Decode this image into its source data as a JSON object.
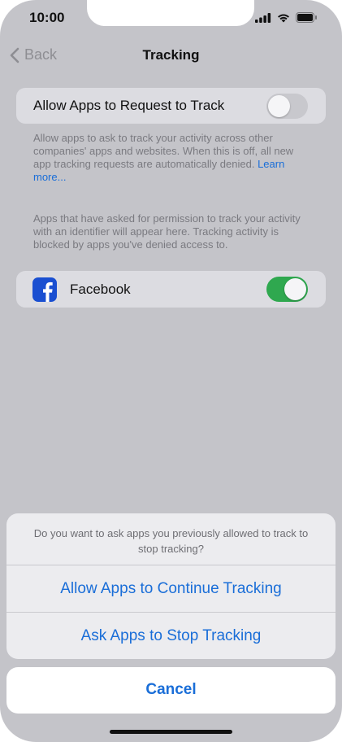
{
  "status_bar": {
    "time": "10:00"
  },
  "nav": {
    "back_label": "Back",
    "title": "Tracking"
  },
  "allow_request": {
    "label": "Allow Apps to Request to Track",
    "enabled": false,
    "description": "Allow apps to ask to track your activity across other companies' apps and websites. When this is off, all new app tracking requests are automatically denied.",
    "learn_more": "Learn more..."
  },
  "apps_info": "Apps that have asked for permission to track your activity with an identifier will appear here. Tracking activity is blocked by apps you've denied access to.",
  "apps": [
    {
      "name": "Facebook",
      "icon": "facebook-icon",
      "enabled": true
    }
  ],
  "action_sheet": {
    "message": "Do you want to ask apps you previously allowed to track to stop tracking?",
    "option_continue": "Allow Apps to Continue Tracking",
    "option_stop": "Ask Apps to Stop Tracking",
    "cancel": "Cancel"
  },
  "colors": {
    "accent": "#1a6ed8",
    "toggle_on": "#2fa84f",
    "toggle_off": "#c8c8cd",
    "facebook": "#1a4fd1"
  }
}
